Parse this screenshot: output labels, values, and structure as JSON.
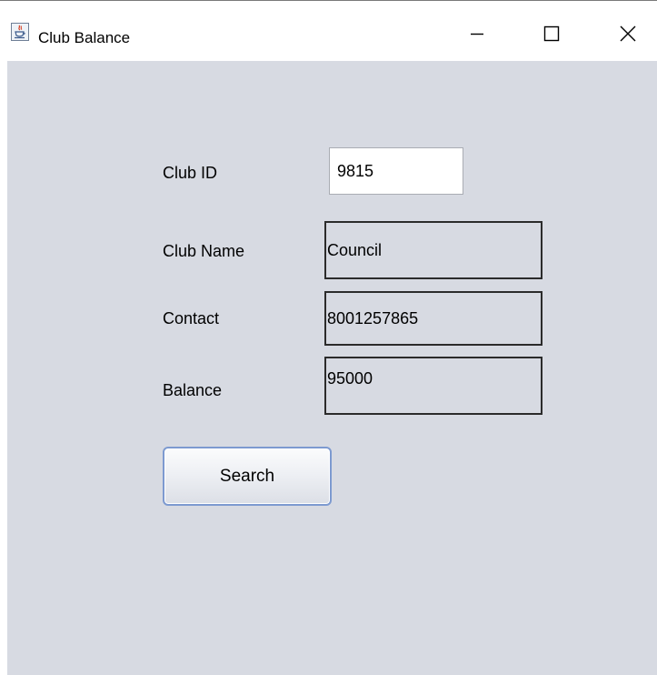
{
  "window": {
    "title": "Club Balance",
    "icons": {
      "app": "java-cup-icon",
      "minimize": "minimize-icon",
      "maximize": "maximize-icon",
      "close": "close-icon"
    }
  },
  "form": {
    "club_id": {
      "label": "Club ID",
      "value": "9815"
    },
    "club_name": {
      "label": "Club Name",
      "value": "Council"
    },
    "contact": {
      "label": "Contact",
      "value": "8001257865"
    },
    "balance": {
      "label": "Balance",
      "value": "95000"
    },
    "search_button": "Search"
  },
  "colors": {
    "content_background": "#d7dae2",
    "button_border": "#7d9ad0",
    "box_border": "#2b2b2b"
  }
}
